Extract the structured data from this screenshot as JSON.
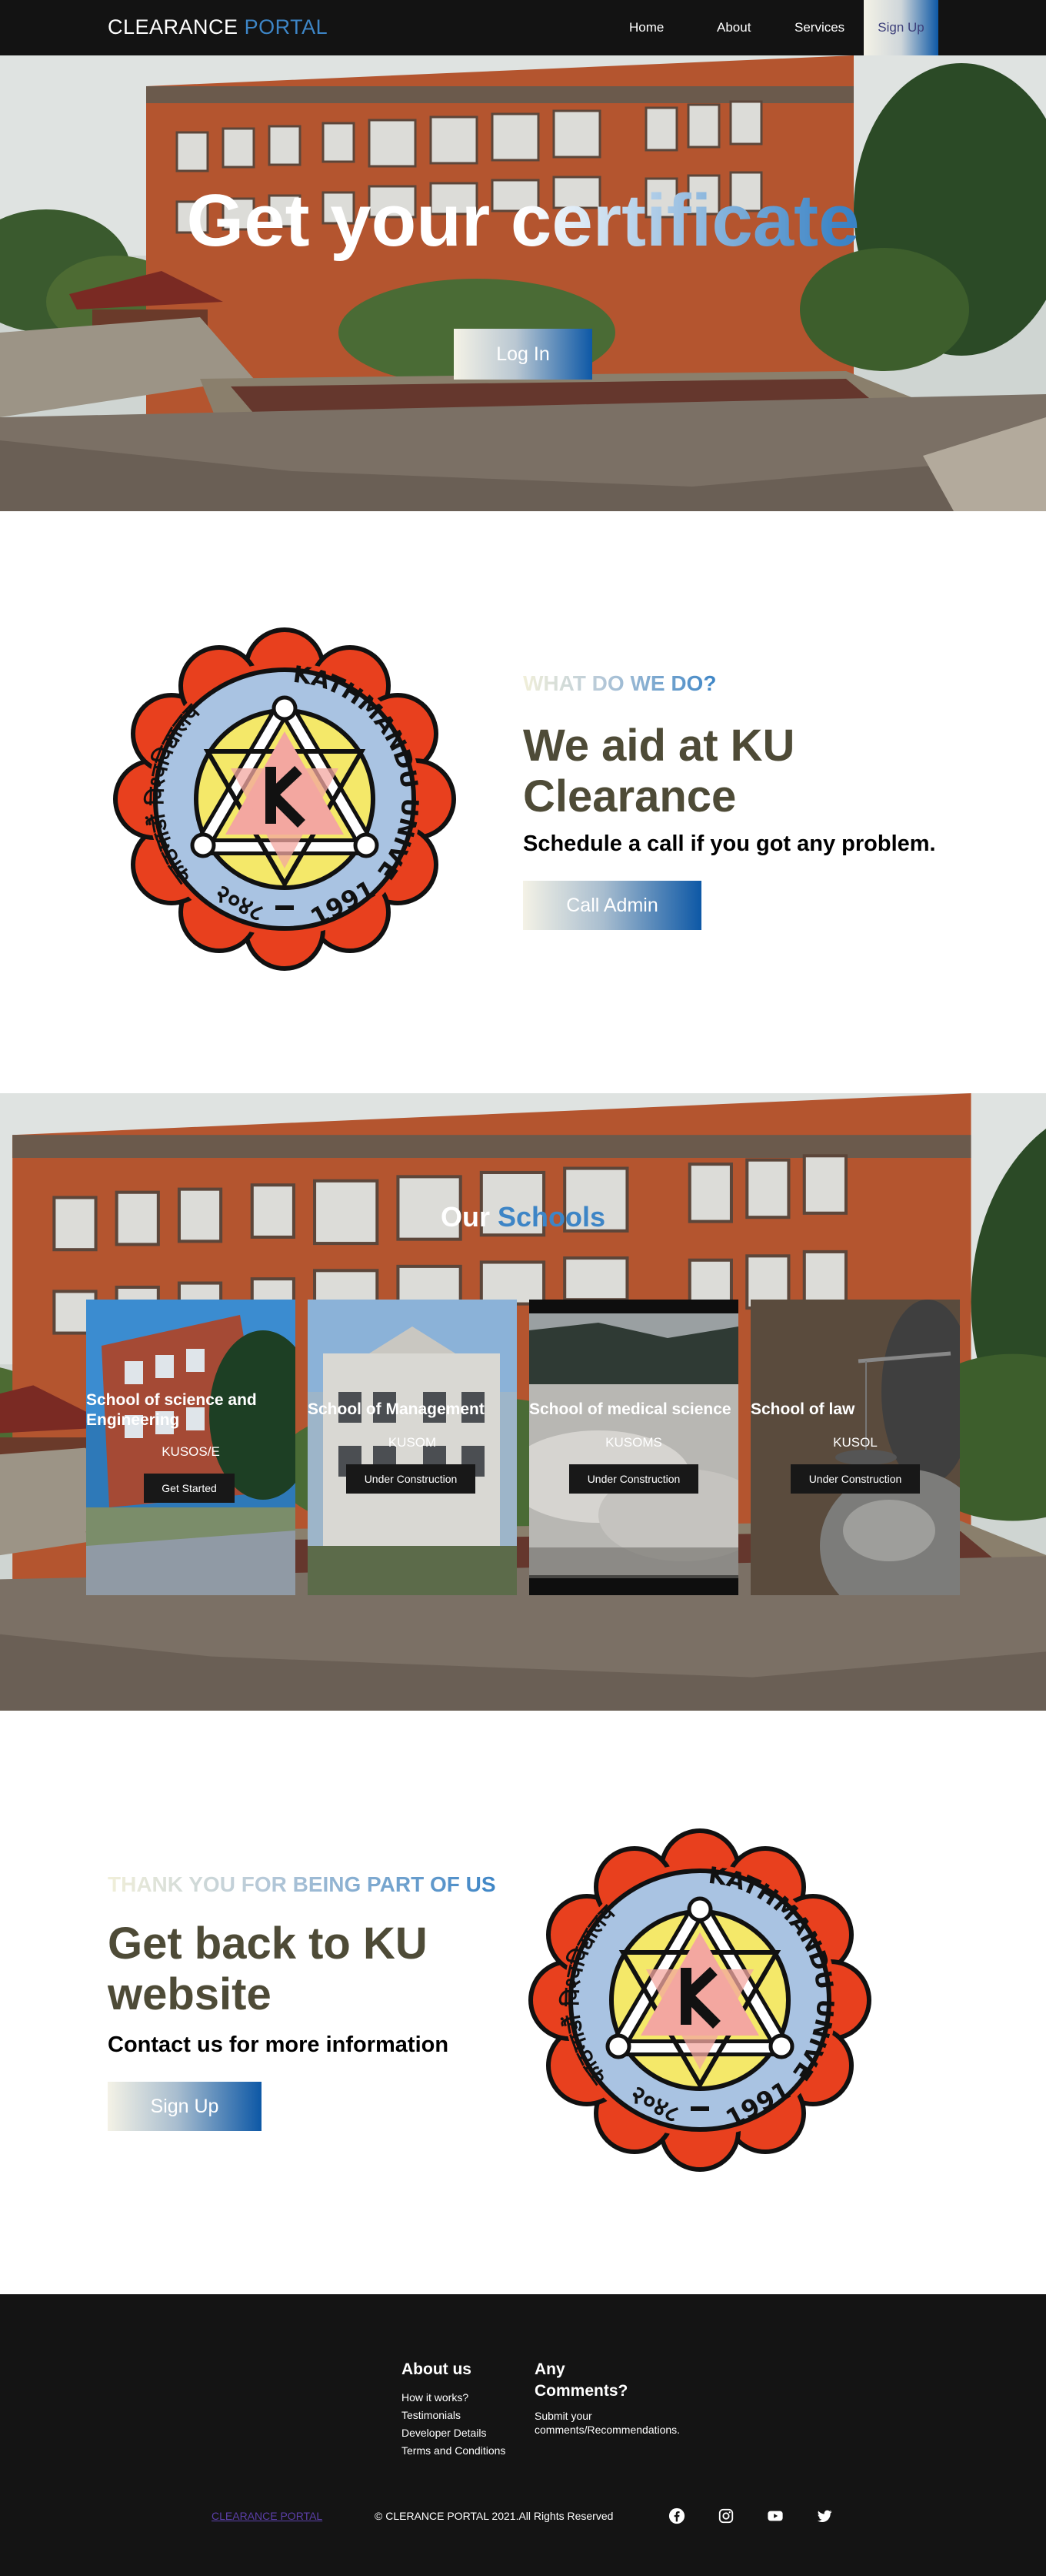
{
  "nav": {
    "brand_part1": "CLEARANCE",
    "brand_part2": "PORTAL",
    "links": [
      "Home",
      "About",
      "Services"
    ],
    "signup_label": "Sign Up"
  },
  "hero": {
    "title": "Get your certificate",
    "login_label": "Log In"
  },
  "logo": {
    "devanagari": "काठमाडौं विश्वविद्यालय",
    "english": "KATHMANDU UNIVERSITY",
    "year_bs": "२०४८",
    "year_ad": "1991",
    "building_sign": "KATHMANDU UNIVERSITY"
  },
  "about": {
    "eyebrow": "WHAT DO WE DO?",
    "headline_line1": "We aid at KU",
    "headline_line2": "Clearance",
    "subline": "Schedule a call if you got any problem.",
    "button_label": "Call Admin"
  },
  "schools": {
    "title_part1": "Our",
    "title_part2": "Schools",
    "cards": [
      {
        "title": "School of science and Engineering",
        "code": "KUSOS/E",
        "button": "Get Started"
      },
      {
        "title": "School of Management",
        "code": "KUSOM",
        "button": "Under Construction"
      },
      {
        "title": "School of medical science",
        "code": "KUSOMS",
        "button": "Under Construction"
      },
      {
        "title": "School of law",
        "code": "KUSOL",
        "button": "Under Construction"
      }
    ]
  },
  "thanks": {
    "eyebrow": "THANK YOU FOR BEING PART OF US",
    "headline_line1": "Get back to KU",
    "headline_line2": "website",
    "subline": "Contact us for more information",
    "button_label": "Sign Up"
  },
  "footer": {
    "about_heading": "About us",
    "about_links": [
      "How it works?",
      "Testimonials",
      "Developer Details",
      "Terms and Conditions"
    ],
    "comments_heading_line1": "Any",
    "comments_heading_line2": "Comments?",
    "comments_text_line1": "Submit your",
    "comments_text_line2": "comments/Recommendations.",
    "brand_link": "CLEARANCE PORTAL",
    "copyright": "© CLERANCE PORTAL 2021.All Rights Reserved",
    "social": [
      "facebook-icon",
      "instagram-icon",
      "youtube-icon",
      "twitter-icon"
    ]
  },
  "colors": {
    "accent_blue": "#3d85c6",
    "nav_bg": "#131313",
    "headline": "#4e4b37",
    "footer_bg": "#141414"
  }
}
